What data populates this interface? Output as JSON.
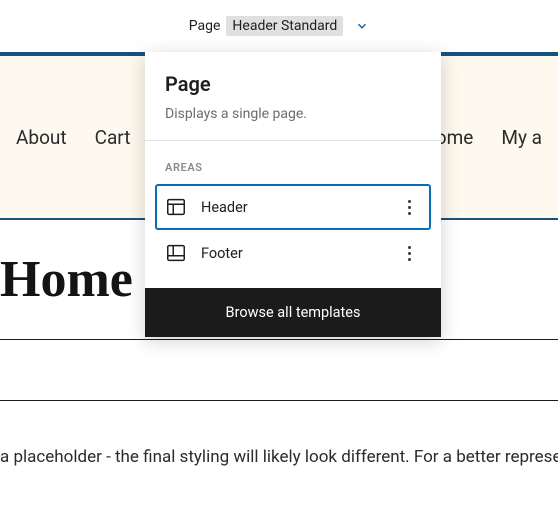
{
  "topbar": {
    "label": "Page",
    "template_name": "Header Standard"
  },
  "dropdown": {
    "title": "Page",
    "description": "Displays a single page.",
    "areas_label": "AREAS",
    "areas": [
      {
        "label": "Header",
        "selected": true
      },
      {
        "label": "Footer",
        "selected": false
      }
    ],
    "browse_label": "Browse all templates"
  },
  "site": {
    "nav": {
      "about": "About",
      "cart": "Cart",
      "home": "Home",
      "mya": "My a"
    },
    "page_title": "Home",
    "body_text": "a placeholder - the final styling will likely look different. For a better representa"
  }
}
